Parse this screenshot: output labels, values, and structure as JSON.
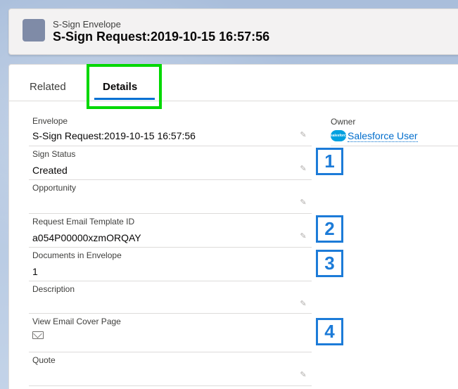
{
  "header": {
    "object_type": "S-Sign Envelope",
    "title": "S-Sign Request:2019-10-15 16:57:56",
    "icon": "envelope-object-icon"
  },
  "tabs": [
    {
      "label": "Related",
      "active": false
    },
    {
      "label": "Details",
      "active": true
    }
  ],
  "fields": {
    "envelope": {
      "label": "Envelope",
      "value": "S-Sign Request:2019-10-15 16:57:56"
    },
    "sign_status": {
      "label": "Sign Status",
      "value": "Created"
    },
    "opportunity": {
      "label": "Opportunity",
      "value": ""
    },
    "request_email_template_id": {
      "label": "Request Email Template ID",
      "value": "a054P00000xzmORQAY"
    },
    "documents_in_envelope": {
      "label": "Documents in Envelope",
      "value": "1"
    },
    "description": {
      "label": "Description",
      "value": ""
    },
    "view_email_cover_page": {
      "label": "View Email Cover Page",
      "icon": "envelope-icon"
    },
    "quote": {
      "label": "Quote",
      "value": ""
    }
  },
  "owner": {
    "label": "Owner",
    "value": "Salesforce User",
    "icon": "salesforce-logo-icon"
  },
  "callouts": [
    "1",
    "2",
    "3",
    "4"
  ],
  "colors": {
    "accent": "#0070d2",
    "highlight": "#00d800",
    "callout": "#1c7bd8"
  }
}
